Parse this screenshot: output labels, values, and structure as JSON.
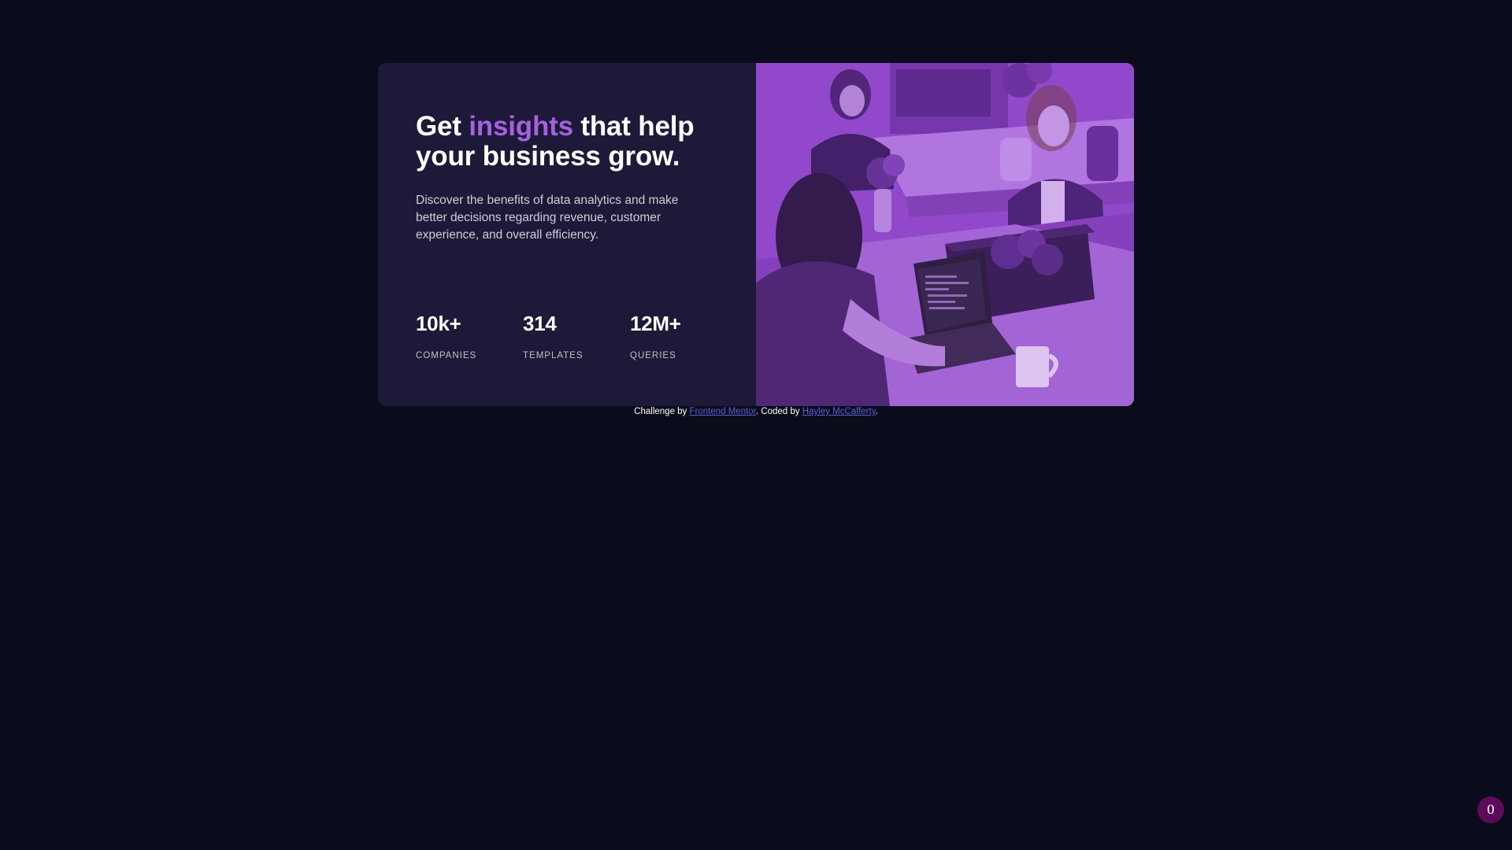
{
  "card": {
    "headline": {
      "before": "Get ",
      "accent": "insights",
      "after": " that help your business grow."
    },
    "description": "Discover the benefits of data analytics and make better decisions regarding revenue, customer experience, and overall efficiency.",
    "stats": [
      {
        "value": "10k+",
        "label": "COMPANIES"
      },
      {
        "value": "314",
        "label": "TEMPLATES"
      },
      {
        "value": "12M+",
        "label": "QUERIES"
      }
    ],
    "image_overlay_color": "#aa5cdb"
  },
  "attribution": {
    "prefix": "Challenge by ",
    "link1": "Frontend Mentor",
    "middle": ". Coded by ",
    "link2": "Hayley McCafferty",
    "suffix": "."
  },
  "badge": {
    "count": "0"
  },
  "colors": {
    "page_background": "#0a0c1c",
    "card_background": "#1c1a38",
    "accent": "#a85fe0",
    "link": "#5a5fd6",
    "badge": "#5d0a5a"
  }
}
